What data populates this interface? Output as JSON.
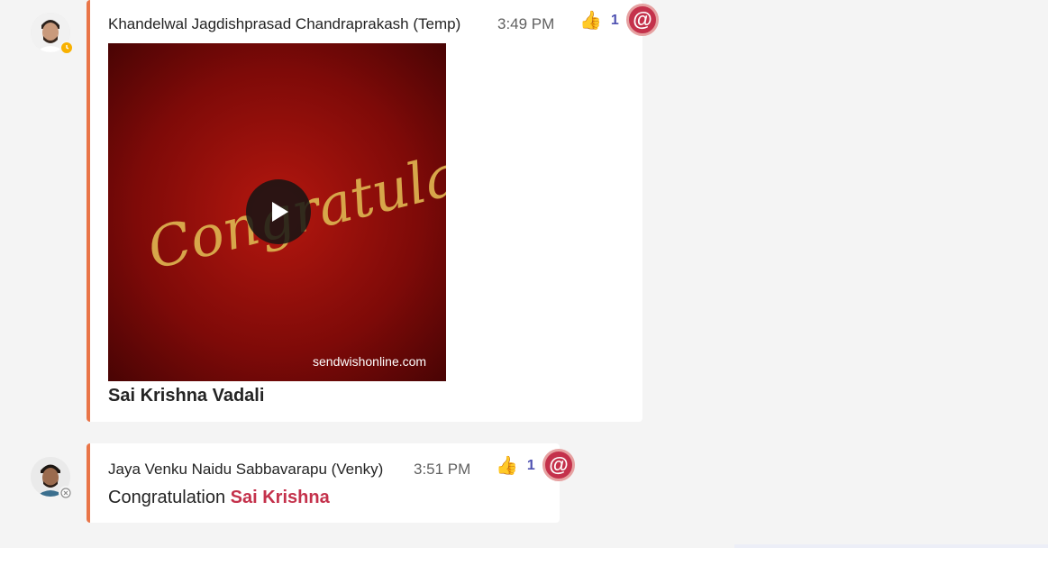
{
  "messages": [
    {
      "sender": "Khandelwal Jagdishprasad Chandraprakash (Temp)",
      "time": "3:49 PM",
      "presence": "away",
      "reaction": {
        "icon": "thumbs-up",
        "count": "1"
      },
      "mention_badge": "@",
      "media": {
        "alt_text": "Congratulations",
        "watermark": "sendwishonline.com",
        "kind": "video"
      },
      "mention": "Sai Krishna Vadali"
    },
    {
      "sender": "Jaya Venku Naidu Sabbavarapu (Venky)",
      "time": "3:51 PM",
      "presence": "offline",
      "reaction": {
        "icon": "thumbs-up",
        "count": "1"
      },
      "mention_badge": "@",
      "text_prefix": "Congratulation ",
      "mention": "Sai Krishna"
    }
  ],
  "colors": {
    "accent_bar": "#e97548",
    "mention": "#c4314b",
    "reaction_count": "#4f52b2",
    "away": "#f8b100"
  }
}
